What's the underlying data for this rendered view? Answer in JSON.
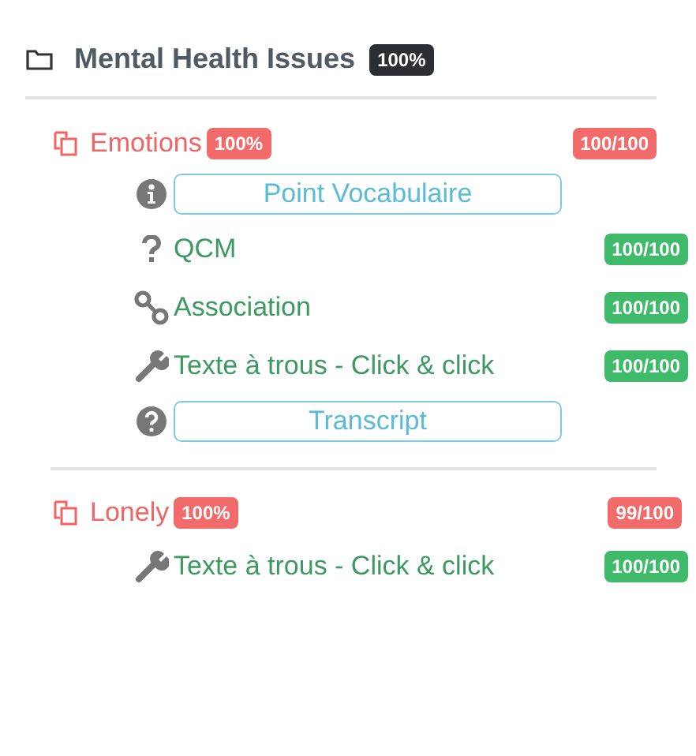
{
  "module": {
    "title": "Mental Health Issues",
    "badge": "100%"
  },
  "sections": [
    {
      "title": "Emotions",
      "badge": "100%",
      "score": "100/100",
      "items": [
        {
          "kind": "info",
          "label": "Point Vocabulaire"
        },
        {
          "kind": "qcm",
          "label": "QCM",
          "score": "100/100"
        },
        {
          "kind": "link",
          "label": "Association",
          "score": "100/100"
        },
        {
          "kind": "tool",
          "label": "Texte à trous - Click & click",
          "score": "100/100"
        },
        {
          "kind": "help",
          "label": "Transcript"
        }
      ]
    },
    {
      "title": "Lonely",
      "badge": "100%",
      "score": "99/100",
      "items": [
        {
          "kind": "tool",
          "label": "Texte à trous - Click & click",
          "score": "100/100"
        }
      ]
    }
  ]
}
